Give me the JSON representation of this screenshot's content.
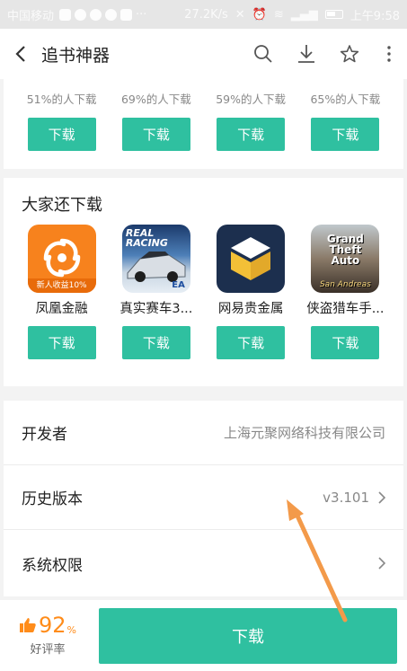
{
  "status_bar": {
    "carrier": "中国移动",
    "speed": "27.2K/s",
    "time": "上午9:58"
  },
  "top_bar": {
    "title": "追书神器",
    "icons": [
      "back-icon",
      "search-icon",
      "download-icon",
      "star-icon",
      "more-icon"
    ]
  },
  "prev_apps": [
    {
      "percent": "51%的人下载",
      "button": "下载"
    },
    {
      "percent": "69%的人下载",
      "button": "下载"
    },
    {
      "percent": "59%的人下载",
      "button": "下载"
    },
    {
      "percent": "65%的人下载",
      "button": "下载"
    }
  ],
  "also_download": {
    "title": "大家还下载",
    "apps": [
      {
        "name": "凤凰金融",
        "badge": "新人收益10%",
        "button": "下载"
      },
      {
        "name": "真实赛车3...",
        "icon_text": "REAL RACING",
        "icon_sub": "EA",
        "button": "下载"
      },
      {
        "name": "网易贵金属",
        "button": "下载"
      },
      {
        "name": "侠盗猎车手...",
        "icon_text": "Grand Theft Auto",
        "icon_sub": "San Andreas",
        "button": "下载"
      }
    ]
  },
  "info": {
    "developer_label": "开发者",
    "developer_value": "上海元聚网络科技有限公司",
    "history_label": "历史版本",
    "history_value": "v3.101",
    "permissions_label": "系统权限"
  },
  "bottom": {
    "rating_value": "92",
    "rating_unit": "%",
    "rating_label": "好评率",
    "download_button": "下载"
  },
  "colors": {
    "accent": "#2fc0a0",
    "rating": "#ff8c1a",
    "arrow": "#f39a4a"
  }
}
